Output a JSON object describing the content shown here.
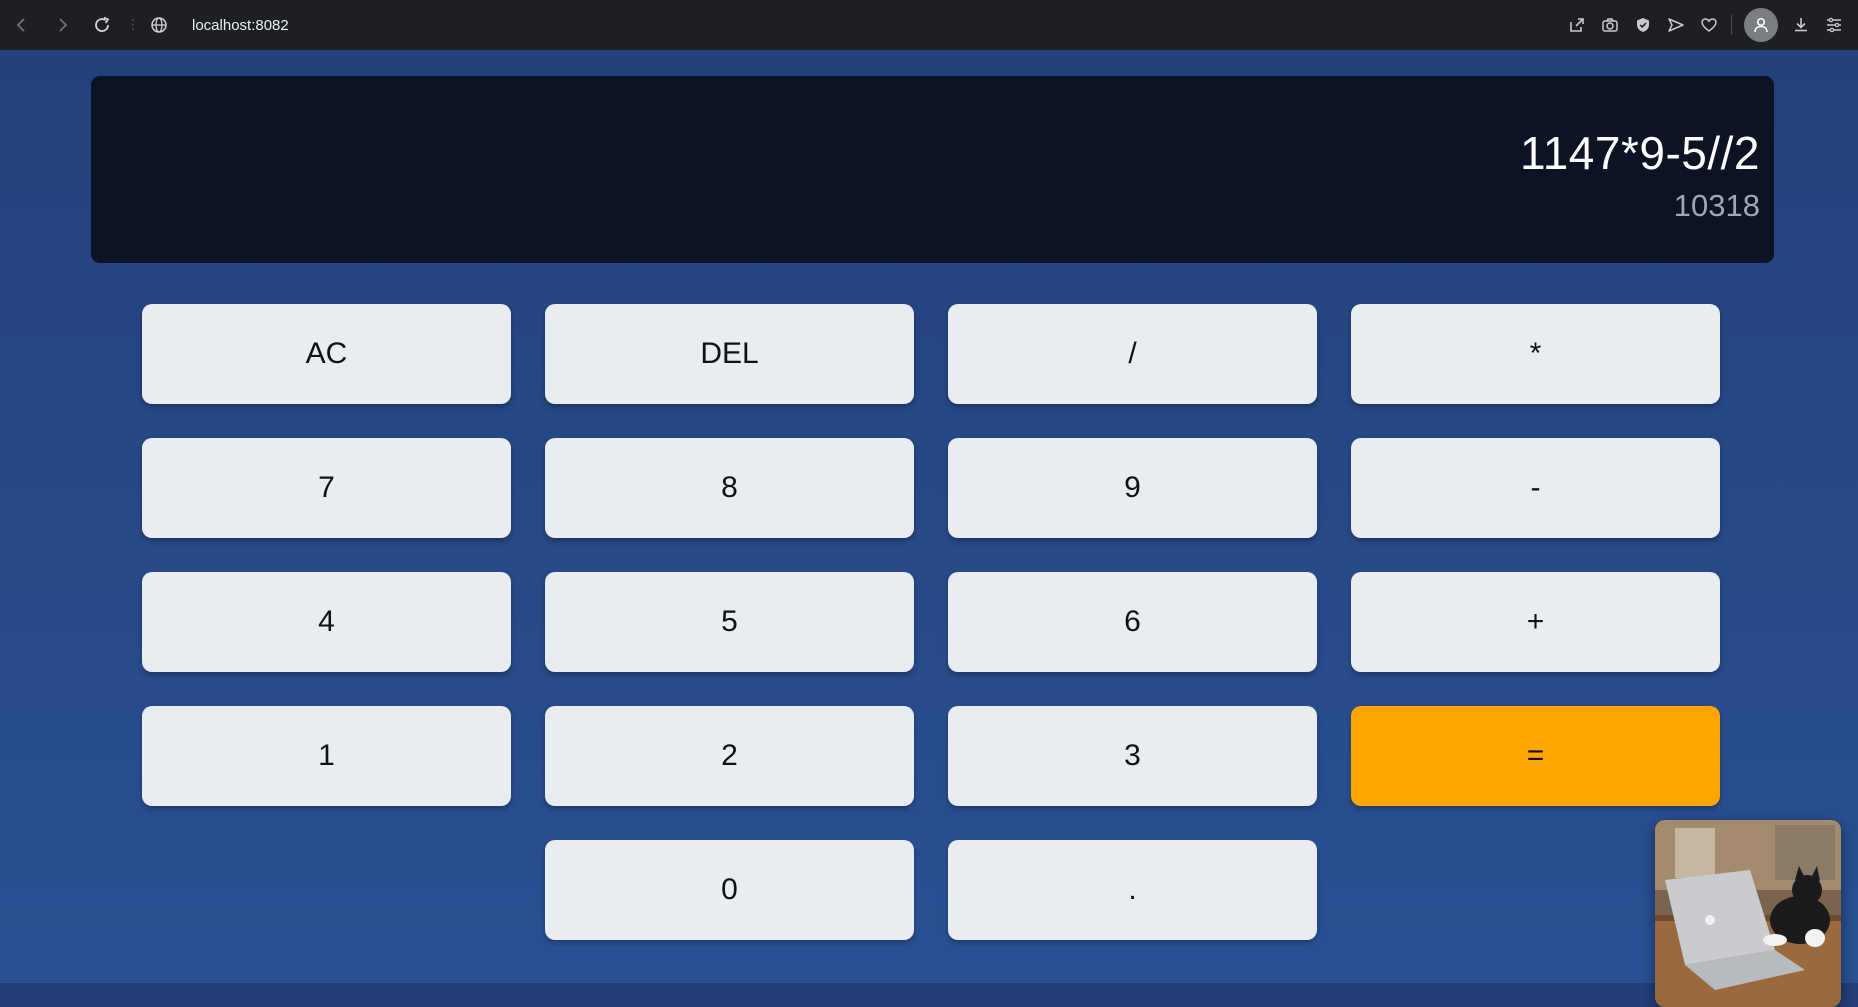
{
  "browser": {
    "url": "localhost:8082"
  },
  "calculator": {
    "expression": "1147*9-5//2",
    "result": "10318",
    "keys": {
      "ac": "AC",
      "del": "DEL",
      "divide": "/",
      "multiply": "*",
      "seven": "7",
      "eight": "8",
      "nine": "9",
      "minus": "-",
      "four": "4",
      "five": "5",
      "six": "6",
      "plus": "+",
      "one": "1",
      "two": "2",
      "three": "3",
      "equals": "=",
      "zero": "0",
      "dot": "."
    }
  },
  "colors": {
    "background": "#2a5194",
    "display_background": "#0b1325",
    "key_background": "#e9ecf1",
    "equals_key": "#ffa500"
  },
  "icons": {
    "back": "arrow-left-icon",
    "forward": "arrow-right-icon",
    "reload": "reload-icon",
    "site_info": "globe-icon",
    "share": "share-icon",
    "screenshot": "camera-icon",
    "shield": "shield-icon",
    "send": "send-icon",
    "favorite": "heart-icon",
    "profile": "user-avatar-icon",
    "download": "download-icon",
    "menu": "menu-icon"
  }
}
